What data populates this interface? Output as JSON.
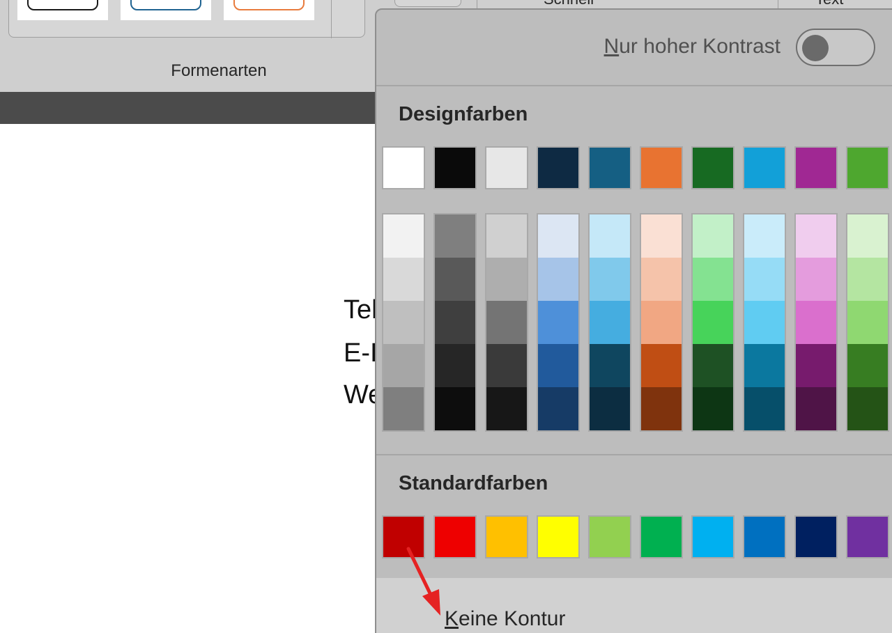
{
  "ribbon": {
    "group_label": "Formenarten",
    "top_text_1": "Schnell",
    "top_text_2": "Text",
    "style_outline_colors": [
      "#1a1a1a",
      "#1f6391",
      "#e87b3d"
    ]
  },
  "document": {
    "lines": [
      "Tel",
      "E-I",
      "We"
    ]
  },
  "flyout": {
    "high_contrast": {
      "label_mnemonic": "N",
      "label_rest": "ur hoher Kontrast",
      "state": "off"
    },
    "design_colors_title": "Designfarben",
    "theme_colors": [
      "#ffffff",
      "#0a0a0a",
      "#e7e7e7",
      "#0e2a43",
      "#155f83",
      "#e87331",
      "#176a22",
      "#12a0d8",
      "#a02893",
      "#4ea72f"
    ],
    "theme_shades": [
      [
        "#f2f2f2",
        "#d9d9d9",
        "#bfbfbf",
        "#a6a6a6",
        "#7f7f7f"
      ],
      [
        "#7f7f7f",
        "#595959",
        "#3f3f3f",
        "#262626",
        "#0d0d0d"
      ],
      [
        "#d0d0d0",
        "#aeaeae",
        "#747474",
        "#3a3a3a",
        "#171717"
      ],
      [
        "#dce6f3",
        "#a6c4e8",
        "#4e90d9",
        "#215a9c",
        "#163b66"
      ],
      [
        "#c5e8f8",
        "#80c9eb",
        "#45ade0",
        "#0f465f",
        "#0c2d41"
      ],
      [
        "#fae0d4",
        "#f5c3aa",
        "#f1a783",
        "#c04e14",
        "#7f330d"
      ],
      [
        "#c2f0c8",
        "#84e291",
        "#47d35a",
        "#1e5124",
        "#0d3614"
      ],
      [
        "#caecfa",
        "#96dcf6",
        "#60ccf2",
        "#0b789f",
        "#064f6a"
      ],
      [
        "#f0cdee",
        "#e49cdd",
        "#da6fcd",
        "#771b6d",
        "#4f1447"
      ],
      [
        "#d9f2d0",
        "#b4e5a1",
        "#8fd871",
        "#377d22",
        "#245316"
      ]
    ],
    "standard_colors_title": "Standardfarben",
    "standard_colors": [
      "#c00000",
      "#ee0000",
      "#ffc000",
      "#ffff00",
      "#92d050",
      "#00b050",
      "#00b0f0",
      "#0070c0",
      "#002060",
      "#7030a0"
    ],
    "no_outline": {
      "label_mnemonic": "K",
      "label_rest": "eine Kontur"
    }
  },
  "annotation_arrow_color": "#e52222"
}
